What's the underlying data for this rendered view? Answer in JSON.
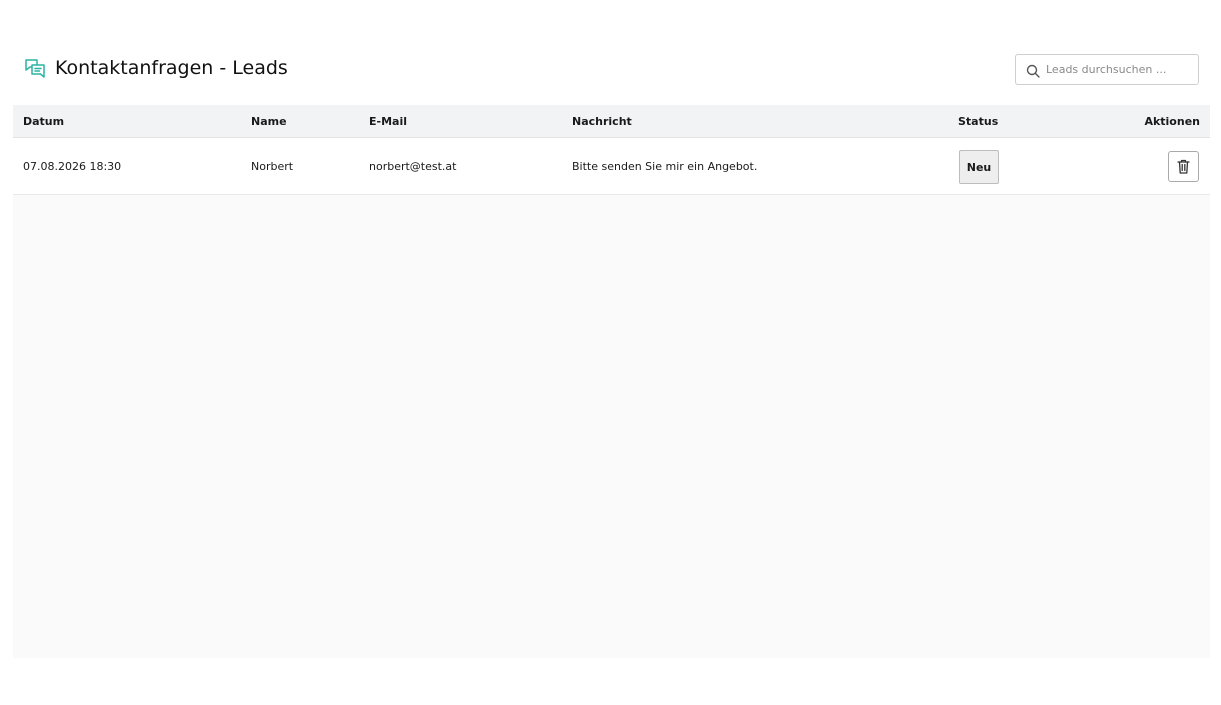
{
  "header": {
    "title": "Kontaktanfragen - Leads",
    "title_icon": "chat-bubbles-icon",
    "accent_color": "#2bb3a3"
  },
  "search": {
    "placeholder": "Leads durchsuchen ...",
    "value": "",
    "icon": "search-icon"
  },
  "table": {
    "columns": {
      "datum": "Datum",
      "name": "Name",
      "email": "E-Mail",
      "nachricht": "Nachricht",
      "status": "Status",
      "aktionen": "Aktionen"
    },
    "rows": [
      {
        "datum": "07.08.2026 18:30",
        "name": "Norbert",
        "email": "norbert@test.at",
        "nachricht": "Bitte senden Sie mir ein Angebot.",
        "status": "Neu",
        "action_icon": "trash-icon"
      }
    ]
  }
}
